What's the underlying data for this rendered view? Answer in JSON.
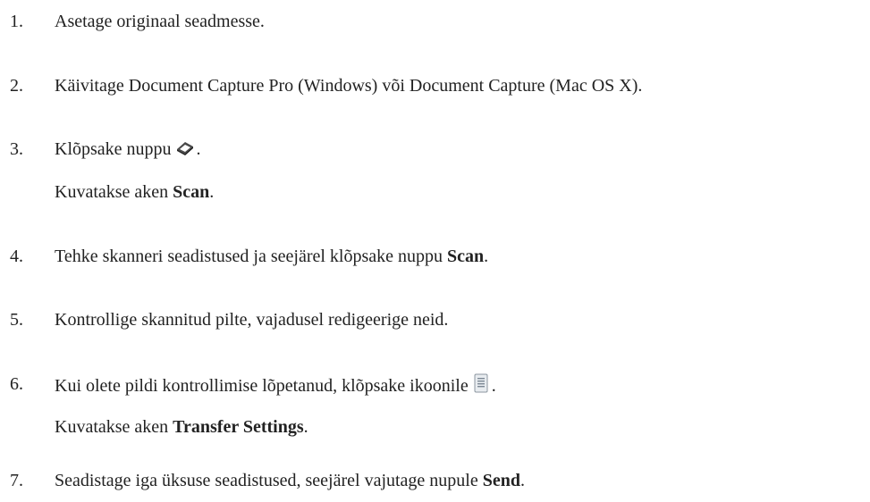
{
  "steps": [
    {
      "num": "1.",
      "text": "Asetage originaal seadmesse."
    },
    {
      "num": "2.",
      "text": "Käivitage Document Capture Pro (Windows) või Document Capture (Mac OS X)."
    },
    {
      "num": "3.",
      "text": "Klõpsake nuppu",
      "after_icon": ".",
      "icon": "scan-icon",
      "sub_prefix": "Kuvatakse aken ",
      "sub_bold": "Scan",
      "sub_suffix": "."
    },
    {
      "num": "4.",
      "text": "Tehke skanneri seadistused ja seejärel klõpsake nuppu ",
      "bold": "Scan",
      "suffix": "."
    },
    {
      "num": "5.",
      "text": "Kontrollige skannitud pilte, vajadusel redigeerige neid."
    },
    {
      "num": "6.",
      "text": "Kui olete pildi kontrollimise lõpetanud, klõpsake ikoonile",
      "after_icon": ".",
      "icon": "document-icon",
      "sub_prefix": "Kuvatakse aken ",
      "sub_bold": "Transfer Settings",
      "sub_suffix": "."
    },
    {
      "num": "7.",
      "text": "Seadistage iga üksuse seadistused, seejärel vajutage nupule ",
      "bold": "Send",
      "suffix": "."
    }
  ]
}
